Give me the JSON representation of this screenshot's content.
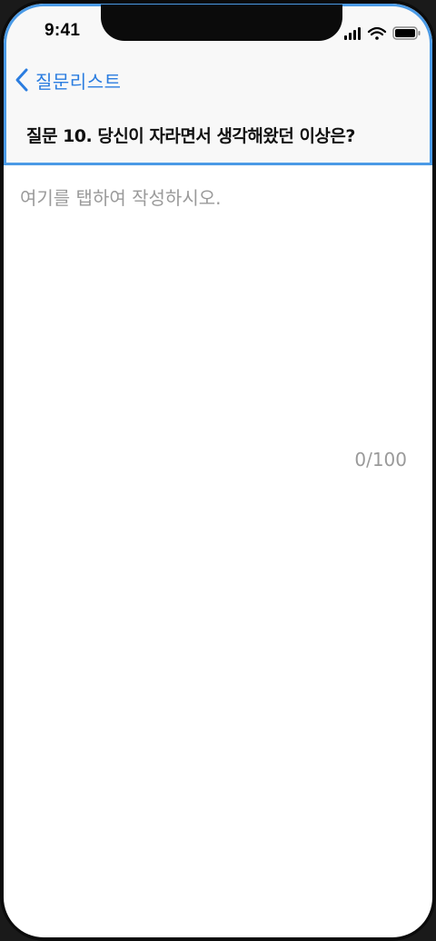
{
  "status_bar": {
    "time": "9:41",
    "icons": [
      "signal-icon",
      "wifi-icon",
      "battery-icon"
    ]
  },
  "nav": {
    "back_label": "질문리스트",
    "back_icon": "chevron-left-icon",
    "accent_color": "#2b7de0"
  },
  "question": {
    "title": "질문 10. 당신이 자라면서 생각해왔던 이상은?"
  },
  "answer": {
    "value": "",
    "placeholder": "여기를 탭하여 작성하시오."
  },
  "counter": {
    "text": "0/100"
  }
}
